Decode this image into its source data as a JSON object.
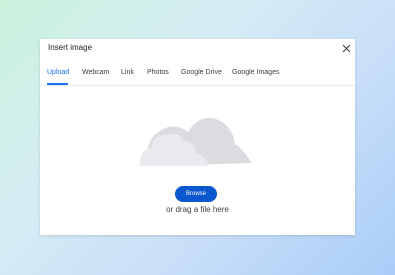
{
  "dialog": {
    "title": "Insert image",
    "close_icon": "close-icon"
  },
  "tabs": [
    {
      "label": "Upload",
      "active": true
    },
    {
      "label": "Webcam",
      "active": false
    },
    {
      "label": "Link",
      "active": false
    },
    {
      "label": "Photos",
      "active": false
    },
    {
      "label": "Google Drive",
      "active": false
    },
    {
      "label": "Google Images",
      "active": false
    }
  ],
  "upload": {
    "illustration_icon": "cloud-icon",
    "browse_label": "Browse",
    "drag_text": "or drag a file here"
  },
  "colors": {
    "accent": "#1a73e8",
    "button": "#0b57d0",
    "cloud_back": "#dadce0",
    "cloud_front": "#e8eaed"
  }
}
